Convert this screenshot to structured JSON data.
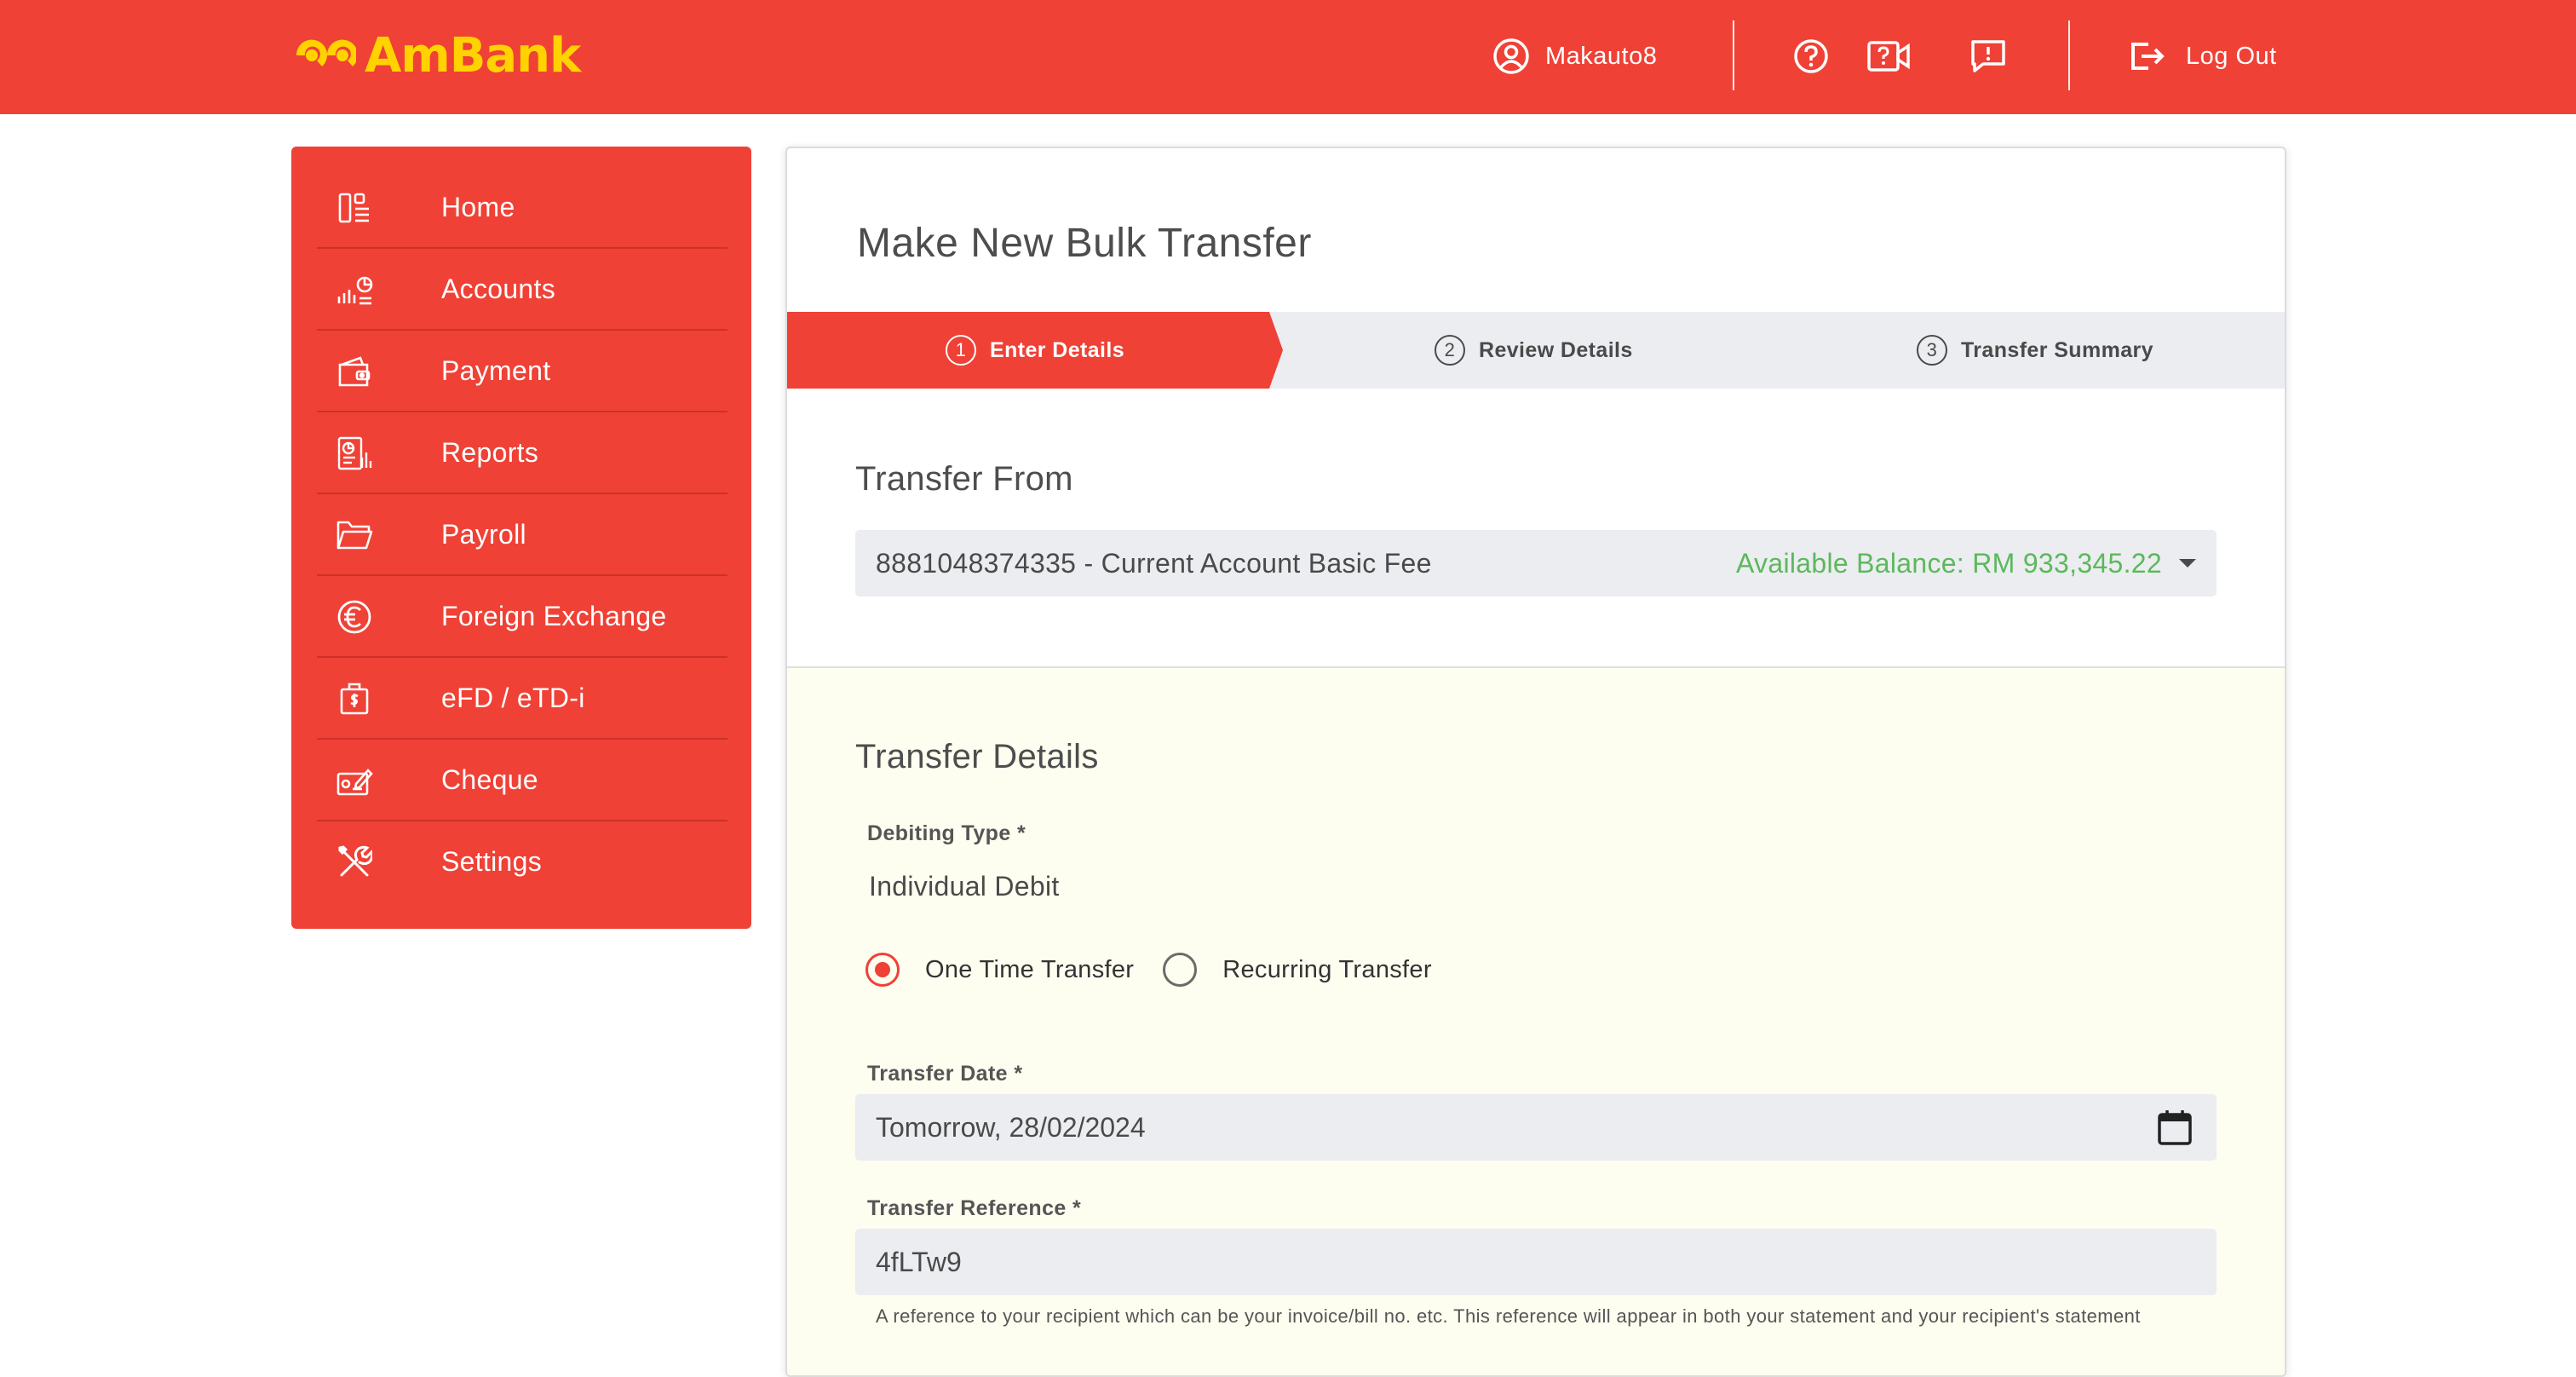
{
  "brand": {
    "name": "AmBank",
    "primary_color": "#ef4136",
    "logo_color": "#ffd200"
  },
  "header": {
    "username": "Makauto8",
    "icons": [
      "user-icon",
      "help-icon",
      "video-help-icon",
      "feedback-icon",
      "logout-icon"
    ],
    "logout_label": "Log Out"
  },
  "sidebar": {
    "items": [
      {
        "label": "Home",
        "icon": "home-dashboard-icon"
      },
      {
        "label": "Accounts",
        "icon": "accounts-chart-icon"
      },
      {
        "label": "Payment",
        "icon": "wallet-icon"
      },
      {
        "label": "Reports",
        "icon": "report-icon"
      },
      {
        "label": "Payroll",
        "icon": "folder-icon"
      },
      {
        "label": "Foreign Exchange",
        "icon": "euro-icon"
      },
      {
        "label": "eFD / eTD-i",
        "icon": "deposit-bag-icon"
      },
      {
        "label": "Cheque",
        "icon": "cheque-icon"
      },
      {
        "label": "Settings",
        "icon": "tools-icon"
      }
    ]
  },
  "main": {
    "title": "Make New Bulk Transfer",
    "steps": [
      {
        "num": "1",
        "label": "Enter Details",
        "active": true
      },
      {
        "num": "2",
        "label": "Review Details",
        "active": false
      },
      {
        "num": "3",
        "label": "Transfer Summary",
        "active": false
      }
    ],
    "transfer_from": {
      "heading": "Transfer From",
      "account": "8881048374335 - Current Account Basic Fee",
      "balance": "Available Balance: RM 933,345.22",
      "balance_color": "#5cb85c"
    },
    "transfer_details": {
      "heading": "Transfer Details",
      "debiting_type_label": "Debiting Type *",
      "debiting_type_value": "Individual Debit",
      "radio_one_time": "One Time Transfer",
      "radio_recurring": "Recurring Transfer",
      "selected_radio": "One Time Transfer",
      "transfer_date_label": "Transfer Date *",
      "transfer_date_value": "Tomorrow, 28/02/2024",
      "transfer_reference_label": "Transfer Reference *",
      "transfer_reference_value": "4fLTw9",
      "transfer_reference_help": "A reference to your recipient which can be your invoice/bill no. etc. This reference will appear in both your statement and your recipient's statement"
    }
  }
}
